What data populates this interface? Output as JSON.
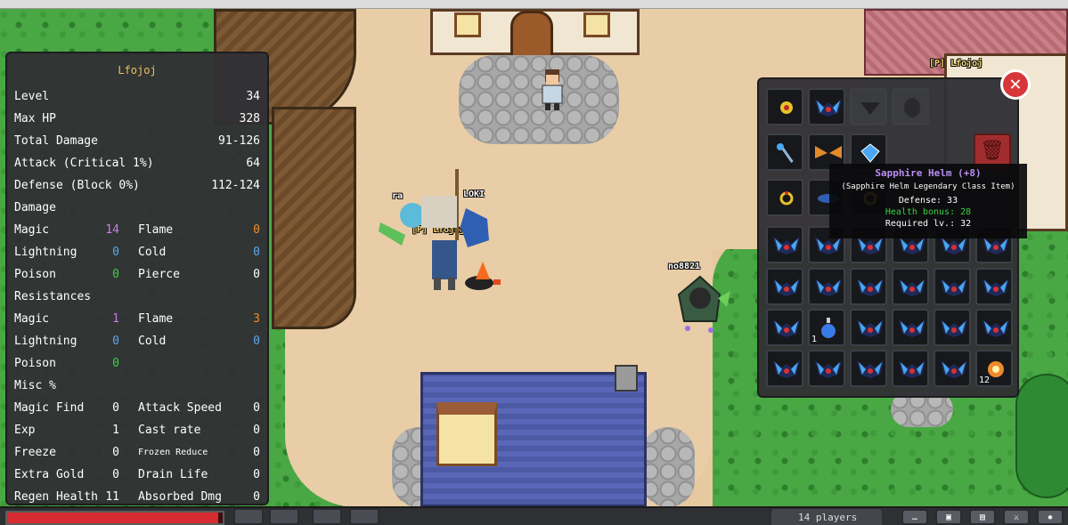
{
  "stats_panel": {
    "title": "Lfojoj",
    "rows": [
      {
        "label": "Level",
        "value": "34"
      },
      {
        "label": "Max HP",
        "value": "328"
      },
      {
        "label": "Total Damage",
        "value": "91-126"
      },
      {
        "label": "Attack (Critical 1%)",
        "value": "64"
      },
      {
        "label": "Defense (Block 0%)",
        "value": "112-124"
      }
    ],
    "damage": {
      "header": "Damage",
      "rows": [
        {
          "a_label": "Magic",
          "a_value": "14",
          "a_color": "#c77ee8",
          "b_label": "Flame",
          "b_value": "0",
          "b_color": "#f08a2c"
        },
        {
          "a_label": "Lightning",
          "a_value": "0",
          "a_color": "#5aa8f0",
          "b_label": "Cold",
          "b_value": "0",
          "b_color": "#5aa8f0"
        },
        {
          "a_label": "Poison",
          "a_value": "0",
          "a_color": "#3cd24a",
          "b_label": "Pierce",
          "b_value": "0",
          "b_color": "#ffffff"
        }
      ]
    },
    "resistances": {
      "header": "Resistances",
      "rows": [
        {
          "a_label": "Magic",
          "a_value": "1",
          "a_color": "#c77ee8",
          "b_label": "Flame",
          "b_value": "3",
          "b_color": "#f08a2c"
        },
        {
          "a_label": "Lightning",
          "a_value": "0",
          "a_color": "#5aa8f0",
          "b_label": "Cold",
          "b_value": "0",
          "b_color": "#5aa8f0"
        },
        {
          "a_label": "Poison",
          "a_value": "0",
          "a_color": "#3cd24a"
        }
      ]
    },
    "misc": {
      "header": "Misc %",
      "rows": [
        {
          "a_label": "Magic Find",
          "a_value": "0",
          "b_label": "Attack Speed",
          "b_value": "0"
        },
        {
          "a_label": "Exp",
          "a_value": "1",
          "b_label": "Cast rate",
          "b_value": "0"
        },
        {
          "a_label": "Freeze",
          "a_value": "0",
          "b_label": "Frozen Reduce",
          "b_value": "0",
          "b_small": true
        },
        {
          "a_label": "Extra Gold",
          "a_value": "0",
          "b_label": "Drain Life",
          "b_value": "0"
        },
        {
          "a_label": "Regen Health",
          "a_value": "11",
          "b_label": "Absorbed Dmg",
          "b_value": "0"
        }
      ]
    }
  },
  "world": {
    "player_label": "[P] Lfojoj",
    "loki_label": "LOKI",
    "ra_label": "ra",
    "enemy_label": "no8821",
    "house_label": "[P] Lfojoj"
  },
  "inventory": {
    "stack_count_potion": "1",
    "stack_count_item": "12",
    "tooltip": {
      "name": "Sapphire Helm (+8)",
      "class_line": "(Sapphire Helm Legendary Class Item)",
      "defense": "Defense: 33",
      "health_bonus": "Health bonus: 28",
      "required": "Required lv.: 32"
    },
    "close_symbol": "✕",
    "trash_symbol": "🗑"
  },
  "bottom_bar": {
    "chat_tab": "14 players",
    "hp_fraction": 0.98,
    "colors": {
      "hp": "#d62c31",
      "accent": "#f2c063"
    }
  },
  "icons": [
    "close-icon",
    "trash-icon",
    "helm-icon",
    "potion-icon",
    "sword-icon",
    "staff-icon",
    "amulet-icon",
    "ring-icon",
    "gem-icon"
  ]
}
